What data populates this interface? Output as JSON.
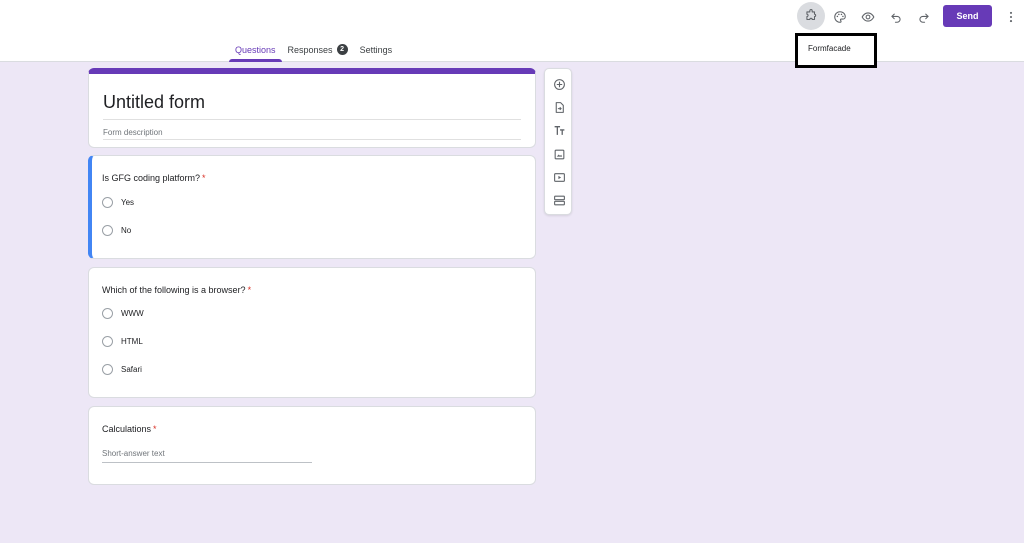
{
  "header": {
    "tabs": [
      {
        "label": "Questions",
        "active": true
      },
      {
        "label": "Responses",
        "badge": "2"
      },
      {
        "label": "Settings"
      }
    ],
    "toolbar": {
      "addon_icon": "puzzle-icon",
      "palette_icon": "palette-icon",
      "preview_icon": "eye-icon",
      "undo_icon": "undo-icon",
      "redo_icon": "redo-icon",
      "send_label": "Send",
      "more_icon": "more-vert-icon"
    },
    "addon_tooltip": "Formfacade"
  },
  "form": {
    "title": "Untitled form",
    "description_placeholder": "Form description"
  },
  "questions": [
    {
      "title": "Is GFG coding platform?",
      "required_mark": "*",
      "options": [
        "Yes",
        "No"
      ]
    },
    {
      "title": "Which of the following is a browser?",
      "required_mark": "*",
      "options": [
        "WWW",
        "HTML",
        "Safari"
      ]
    },
    {
      "title": "Calculations",
      "required_mark": "*",
      "short_answer_placeholder": "Short-answer text"
    }
  ],
  "side_toolbar": [
    {
      "icon": "add-question-icon"
    },
    {
      "icon": "import-questions-icon"
    },
    {
      "icon": "add-title-icon"
    },
    {
      "icon": "add-image-icon"
    },
    {
      "icon": "add-video-icon"
    },
    {
      "icon": "add-section-icon"
    }
  ],
  "colors": {
    "accent": "#673ab7",
    "active_card_strip": "#4285f4",
    "background": "#ede7f6",
    "required": "#d93025"
  }
}
